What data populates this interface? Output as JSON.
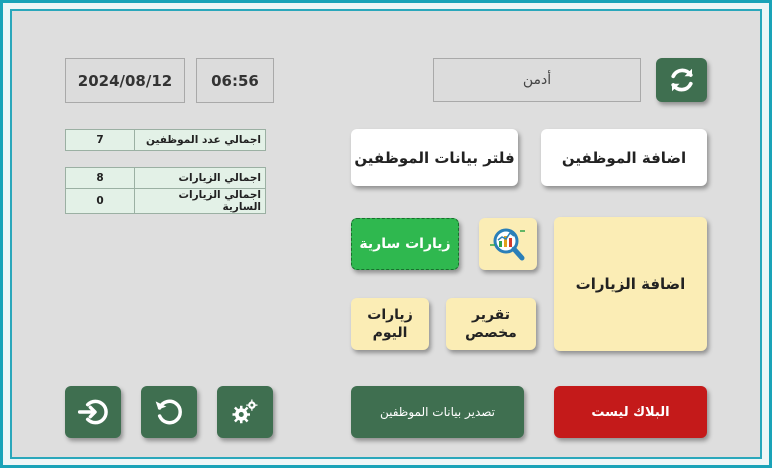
{
  "header": {
    "date": "2024/08/12",
    "time": "06:56",
    "user_name": "أدمن",
    "refresh_icon": "refresh-icon"
  },
  "stats": {
    "rows": [
      {
        "label": "اجمالي عدد الموظفين",
        "value": "7"
      },
      {
        "label": "اجمالي الزيارات",
        "value": "8"
      },
      {
        "label": "اجمالي الزيارات السارية",
        "value": "0"
      }
    ]
  },
  "actions": {
    "add_employee": "اضافة الموظفين",
    "filter_employees": "فلتر بيانات الموظفين",
    "add_visits": "اضافة الزيارات",
    "active_visits": "زيارات سارية",
    "custom_report": "تقرير\nمخصص",
    "today_visits": "زيارات\nاليوم",
    "blacklist": "البلاك ليست",
    "export_employees": "تصدير بيانات الموظفين"
  },
  "icons": {
    "report_search": "chart-search-icon",
    "logout": "logout-icon",
    "reset": "reload-icon",
    "settings": "gears-icon"
  },
  "colors": {
    "frame": "#1aa3b8",
    "green": "#3f6f50",
    "live_green": "#2fb84f",
    "red": "#c41a1a",
    "cream": "#fbedb5"
  }
}
